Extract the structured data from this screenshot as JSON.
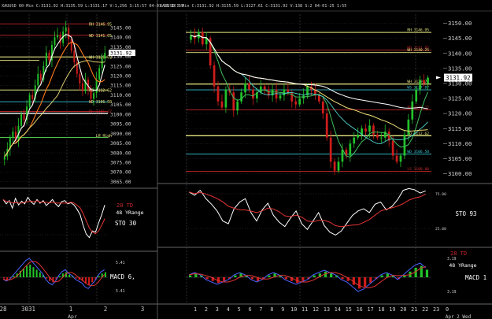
{
  "colors": {
    "background": "#000000",
    "up_candle": "#22c32a",
    "down_candle": "#d01c1c",
    "ma_white": "#ffffff",
    "ma_orange": "#ff7a1a",
    "ma_yellow": "#f3e27a",
    "ma_green": "#3fbf5a",
    "ma_cyan": "#4fd5d0",
    "level_red": "#c3272b",
    "level_yellow": "#e6e680",
    "level_cyan": "#35c7d6",
    "level_green": "#4fc24f",
    "macd_blue": "#4a63ff",
    "macd_red": "#e23434",
    "grid": "#3a3a3a",
    "text": "#cfcfcf"
  },
  "left_chart": {
    "header": "XAUUSD 60-Min  C:3131.92  H:3135.59  L:3131.17  V:1,256  3:15:57 04-01-25  36.55",
    "price_labels": [
      "3145.00",
      "3140.00",
      "3135.00",
      "3130.00",
      "3125.00",
      "3120.00",
      "3115.00",
      "3110.00",
      "3105.00",
      "3100.00",
      "3095.00",
      "3090.00",
      "3085.00",
      "3080.00",
      "3075.00",
      "3070.00",
      "3065.00"
    ],
    "annotations": [
      "RH  3146.95",
      "WD  3141.05",
      "WH  3129.78",
      "WD  3112.62",
      "WD  3106.50",
      "LH High",
      "PL  3101.47"
    ],
    "bottom_x_labels": [
      "28",
      "3031",
      "1",
      "2",
      "3"
    ],
    "month_label": "Apr",
    "sto_title": "STO  30",
    "sto_td": "28 TD",
    "sto_range": "48 YRange",
    "macd_title": "MACD 6,",
    "macd_values": [
      "5.41",
      "5.41"
    ]
  },
  "right_chart": {
    "header": "XAUUSD  5-Min  C:3131.92  H:3135.59  L:3127.61  C:3131.92  V:138  S:2  04-01-25  1:55",
    "current_price": "3131.92",
    "price_labels": [
      "3150.00",
      "3145.00",
      "3140.00",
      "3135.00",
      "3130.00",
      "3125.00",
      "3120.00",
      "3115.00",
      "3110.00",
      "3105.00",
      "3100.00"
    ],
    "annotations": [
      "RH  3146.95",
      "WD  3141.05",
      "WH  3140.25",
      "WH  3129.78",
      "WS  3127.87",
      "PP  3121.22",
      "WD  3112.62",
      "WD  3106.50",
      "LS  3100.80"
    ],
    "x_labels": [
      "1",
      "2",
      "3",
      "4",
      "5",
      "6",
      "7",
      "8",
      "9",
      "10",
      "11",
      "12",
      "13",
      "14",
      "15",
      "16",
      "17",
      "18",
      "19",
      "20",
      "21",
      "22",
      "23",
      "0"
    ],
    "x_sub_labels": [
      "Apr 2 Wed"
    ],
    "sto_title": "STO  93",
    "sto_levels": [
      "75.00",
      "25.00"
    ],
    "macd_title": "MACD 1",
    "macd_td": "28 TD",
    "macd_range": "48 YRange",
    "macd_values": [
      "3.19",
      "3.19"
    ]
  },
  "chart_data": [
    {
      "type": "candlestick",
      "title": "XAUUSD 60-Min",
      "ylim": [
        3062,
        3152
      ],
      "x_labels": [
        "28",
        "30",
        "31",
        "1",
        "2",
        "3"
      ],
      "closes": [
        3078,
        3082,
        3088,
        3091,
        3086,
        3094,
        3100,
        3097,
        3104,
        3110,
        3108,
        3115,
        3121,
        3118,
        3125,
        3132,
        3128,
        3136,
        3140,
        3141,
        3137,
        3143,
        3145,
        3139,
        3133,
        3127,
        3121,
        3116,
        3112,
        3118,
        3113,
        3108,
        3111,
        3118,
        3124,
        3129,
        3131.92
      ],
      "levels": [
        {
          "name": "RH",
          "value": 3146.95
        },
        {
          "name": "WD",
          "value": 3141.05
        },
        {
          "name": "WH",
          "value": 3129.78
        },
        {
          "name": "WD",
          "value": 3112.62
        },
        {
          "name": "WD",
          "value": 3106.5
        },
        {
          "name": "PL",
          "value": 3101.47
        }
      ]
    },
    {
      "type": "candlestick",
      "title": "XAUUSD 5-Min",
      "ylim": [
        3097,
        3153
      ],
      "x_labels": [
        "1",
        "2",
        "3",
        "4",
        "5",
        "6",
        "7",
        "8",
        "9",
        "10",
        "11",
        "12",
        "13",
        "14",
        "15",
        "16",
        "17",
        "18",
        "19",
        "20",
        "21",
        "22",
        "23",
        "0"
      ],
      "closes": [
        3146,
        3145,
        3147,
        3143,
        3145,
        3136,
        3129,
        3124,
        3122,
        3128,
        3127,
        3121,
        3124,
        3127,
        3130,
        3128,
        3125,
        3127,
        3129,
        3128,
        3126,
        3128,
        3125,
        3126,
        3128,
        3127,
        3124,
        3123,
        3125,
        3126,
        3129,
        3128,
        3126,
        3124,
        3120,
        3112,
        3104,
        3101,
        3104,
        3108,
        3106,
        3110,
        3112,
        3113,
        3115,
        3114,
        3116,
        3113,
        3112,
        3112,
        3114,
        3111,
        3106,
        3104,
        3106,
        3113,
        3118,
        3124,
        3128,
        3131,
        3130,
        3131.92
      ],
      "levels": [
        {
          "name": "RH",
          "value": 3146.95
        },
        {
          "name": "WD",
          "value": 3141.05
        },
        {
          "name": "WH",
          "value": 3140.25
        },
        {
          "name": "WH",
          "value": 3129.78
        },
        {
          "name": "WS",
          "value": 3127.87
        },
        {
          "name": "PP",
          "value": 3121.22
        },
        {
          "name": "WD",
          "value": 3112.62
        },
        {
          "name": "WD",
          "value": 3106.5
        },
        {
          "name": "LS",
          "value": 3100.8
        }
      ]
    }
  ]
}
